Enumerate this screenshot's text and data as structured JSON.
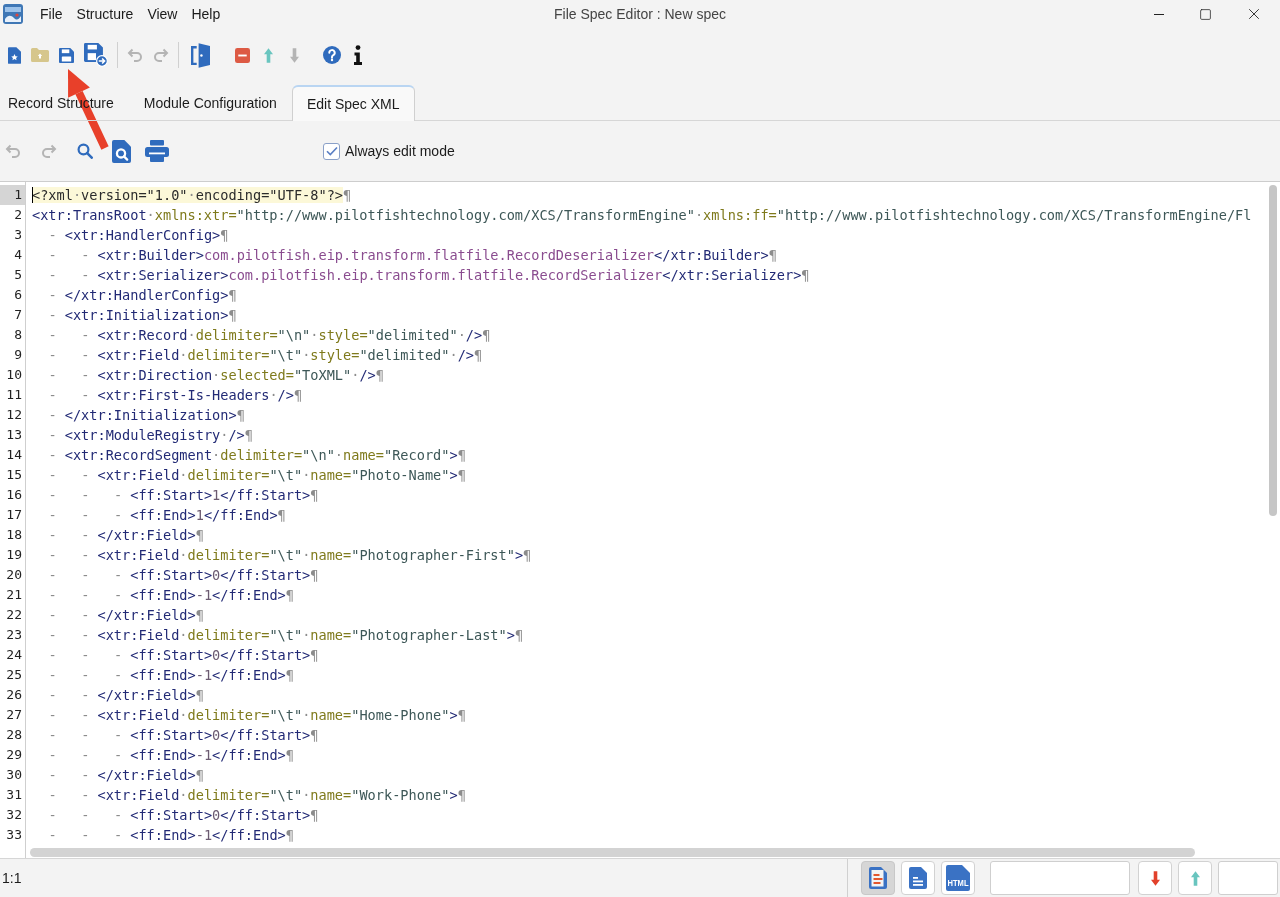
{
  "window": {
    "title": "File Spec Editor : New spec"
  },
  "menu": [
    "File",
    "Structure",
    "View",
    "Help"
  ],
  "toolbar": [
    {
      "kind": "new",
      "disabled": false
    },
    {
      "kind": "open",
      "disabled": false
    },
    {
      "kind": "save",
      "disabled": false
    },
    {
      "kind": "save-as",
      "disabled": false
    },
    {
      "kind": "separator"
    },
    {
      "kind": "undo",
      "disabled": true
    },
    {
      "kind": "redo",
      "disabled": true
    },
    {
      "kind": "separator"
    },
    {
      "kind": "exit",
      "disabled": false
    },
    {
      "kind": "remove",
      "disabled": false
    },
    {
      "kind": "move-up",
      "disabled": false
    },
    {
      "kind": "move-down",
      "disabled": true
    },
    {
      "kind": "help",
      "disabled": false
    },
    {
      "kind": "about",
      "disabled": false
    }
  ],
  "tabs": [
    {
      "label": "Record Structure",
      "selected": false
    },
    {
      "label": "Module Configuration",
      "selected": false
    },
    {
      "label": "Edit Spec XML",
      "selected": true
    }
  ],
  "editor_toolbar": {
    "buttons": [
      {
        "kind": "undo",
        "disabled": true
      },
      {
        "kind": "redo",
        "disabled": true
      },
      {
        "kind": "find",
        "disabled": false
      },
      {
        "kind": "find-in-file",
        "disabled": false
      },
      {
        "kind": "print",
        "disabled": false
      }
    ],
    "always_edit_mode": {
      "label": "Always edit mode",
      "checked": true
    }
  },
  "editor": {
    "lines": [
      {
        "number": "1",
        "current": true,
        "tokens": [
          {
            "kind": "pi",
            "text": "<?xml"
          },
          {
            "kind": "space",
            "text": "·"
          },
          {
            "kind": "pi",
            "text": "version=\"1.0\""
          },
          {
            "kind": "space",
            "text": "·"
          },
          {
            "kind": "pi",
            "text": "encoding=\"UTF-8\"?>"
          },
          {
            "kind": "eol",
            "text": "¶"
          }
        ]
      },
      {
        "number": "2",
        "current": false,
        "tokens": [
          {
            "kind": "tag",
            "text": "<xtr:TransRoot"
          },
          {
            "kind": "space",
            "text": "·"
          },
          {
            "kind": "attr",
            "text": "xmlns:xtr="
          },
          {
            "kind": "value",
            "text": "\"http://www.pilotfishtechnology.com/XCS/TransformEngine\""
          },
          {
            "kind": "space",
            "text": "·"
          },
          {
            "kind": "attr",
            "text": "xmlns:ff="
          },
          {
            "kind": "value",
            "text": "\"http://www.pilotfishtechnology.com/XCS/TransformEngine/Fl"
          }
        ]
      },
      {
        "number": "3",
        "current": false,
        "tokens": [
          {
            "kind": "guide",
            "text": "-"
          },
          {
            "kind": "tag",
            "text": "<xtr:HandlerConfig>"
          },
          {
            "kind": "eol",
            "text": "¶"
          }
        ]
      },
      {
        "number": "4",
        "current": false,
        "tokens": [
          {
            "kind": "guide",
            "text": "-"
          },
          {
            "kind": "guide",
            "text": "-"
          },
          {
            "kind": "tag",
            "text": "<xtr:Builder>"
          },
          {
            "kind": "text",
            "text": "com.pilotfish.eip.transform.flatfile.RecordDeserializer"
          },
          {
            "kind": "tag",
            "text": "</xtr:Builder>"
          },
          {
            "kind": "eol",
            "text": "¶"
          }
        ]
      },
      {
        "number": "5",
        "current": false,
        "tokens": [
          {
            "kind": "guide",
            "text": "-"
          },
          {
            "kind": "guide",
            "text": "-"
          },
          {
            "kind": "tag",
            "text": "<xtr:Serializer>"
          },
          {
            "kind": "text",
            "text": "com.pilotfish.eip.transform.flatfile.RecordSerializer"
          },
          {
            "kind": "tag",
            "text": "</xtr:Serializer>"
          },
          {
            "kind": "eol",
            "text": "¶"
          }
        ]
      },
      {
        "number": "6",
        "current": false,
        "tokens": [
          {
            "kind": "guide",
            "text": "-"
          },
          {
            "kind": "tag",
            "text": "</xtr:HandlerConfig>"
          },
          {
            "kind": "eol",
            "text": "¶"
          }
        ]
      },
      {
        "number": "7",
        "current": false,
        "tokens": [
          {
            "kind": "guide",
            "text": "-"
          },
          {
            "kind": "tag",
            "text": "<xtr:Initialization>"
          },
          {
            "kind": "eol",
            "text": "¶"
          }
        ]
      },
      {
        "number": "8",
        "current": false,
        "tokens": [
          {
            "kind": "guide",
            "text": "-"
          },
          {
            "kind": "guide",
            "text": "-"
          },
          {
            "kind": "tag",
            "text": "<xtr:Record"
          },
          {
            "kind": "space",
            "text": "·"
          },
          {
            "kind": "attr",
            "text": "delimiter="
          },
          {
            "kind": "value",
            "text": "\"\\n\""
          },
          {
            "kind": "space",
            "text": "·"
          },
          {
            "kind": "attr",
            "text": "style="
          },
          {
            "kind": "value",
            "text": "\"delimited\""
          },
          {
            "kind": "space",
            "text": "·"
          },
          {
            "kind": "tag",
            "text": "/>"
          },
          {
            "kind": "eol",
            "text": "¶"
          }
        ]
      },
      {
        "number": "9",
        "current": false,
        "tokens": [
          {
            "kind": "guide",
            "text": "-"
          },
          {
            "kind": "guide",
            "text": "-"
          },
          {
            "kind": "tag",
            "text": "<xtr:Field"
          },
          {
            "kind": "space",
            "text": "·"
          },
          {
            "kind": "attr",
            "text": "delimiter="
          },
          {
            "kind": "value",
            "text": "\"\\t\""
          },
          {
            "kind": "space",
            "text": "·"
          },
          {
            "kind": "attr",
            "text": "style="
          },
          {
            "kind": "value",
            "text": "\"delimited\""
          },
          {
            "kind": "space",
            "text": "·"
          },
          {
            "kind": "tag",
            "text": "/>"
          },
          {
            "kind": "eol",
            "text": "¶"
          }
        ]
      },
      {
        "number": "10",
        "current": false,
        "tokens": [
          {
            "kind": "guide",
            "text": "-"
          },
          {
            "kind": "guide",
            "text": "-"
          },
          {
            "kind": "tag",
            "text": "<xtr:Direction"
          },
          {
            "kind": "space",
            "text": "·"
          },
          {
            "kind": "attr",
            "text": "selected="
          },
          {
            "kind": "value",
            "text": "\"ToXML\""
          },
          {
            "kind": "space",
            "text": "·"
          },
          {
            "kind": "tag",
            "text": "/>"
          },
          {
            "kind": "eol",
            "text": "¶"
          }
        ]
      },
      {
        "number": "11",
        "current": false,
        "tokens": [
          {
            "kind": "guide",
            "text": "-"
          },
          {
            "kind": "guide",
            "text": "-"
          },
          {
            "kind": "tag",
            "text": "<xtr:First-Is-Headers"
          },
          {
            "kind": "space",
            "text": "·"
          },
          {
            "kind": "tag",
            "text": "/>"
          },
          {
            "kind": "eol",
            "text": "¶"
          }
        ]
      },
      {
        "number": "12",
        "current": false,
        "tokens": [
          {
            "kind": "guide",
            "text": "-"
          },
          {
            "kind": "tag",
            "text": "</xtr:Initialization>"
          },
          {
            "kind": "eol",
            "text": "¶"
          }
        ]
      },
      {
        "number": "13",
        "current": false,
        "tokens": [
          {
            "kind": "guide",
            "text": "-"
          },
          {
            "kind": "tag",
            "text": "<xtr:ModuleRegistry"
          },
          {
            "kind": "space",
            "text": "·"
          },
          {
            "kind": "tag",
            "text": "/>"
          },
          {
            "kind": "eol",
            "text": "¶"
          }
        ]
      },
      {
        "number": "14",
        "current": false,
        "tokens": [
          {
            "kind": "guide",
            "text": "-"
          },
          {
            "kind": "tag",
            "text": "<xtr:RecordSegment"
          },
          {
            "kind": "space",
            "text": "·"
          },
          {
            "kind": "attr",
            "text": "delimiter="
          },
          {
            "kind": "value",
            "text": "\"\\n\""
          },
          {
            "kind": "space",
            "text": "·"
          },
          {
            "kind": "attr",
            "text": "name="
          },
          {
            "kind": "value",
            "text": "\"Record\""
          },
          {
            "kind": "tag",
            "text": ">"
          },
          {
            "kind": "eol",
            "text": "¶"
          }
        ]
      },
      {
        "number": "15",
        "current": false,
        "tokens": [
          {
            "kind": "guide",
            "text": "-"
          },
          {
            "kind": "guide",
            "text": "-"
          },
          {
            "kind": "tag",
            "text": "<xtr:Field"
          },
          {
            "kind": "space",
            "text": "·"
          },
          {
            "kind": "attr",
            "text": "delimiter="
          },
          {
            "kind": "value",
            "text": "\"\\t\""
          },
          {
            "kind": "space",
            "text": "·"
          },
          {
            "kind": "attr",
            "text": "name="
          },
          {
            "kind": "value",
            "text": "\"Photo-Name\""
          },
          {
            "kind": "tag",
            "text": ">"
          },
          {
            "kind": "eol",
            "text": "¶"
          }
        ]
      },
      {
        "number": "16",
        "current": false,
        "tokens": [
          {
            "kind": "guide",
            "text": "-"
          },
          {
            "kind": "guide",
            "text": "-"
          },
          {
            "kind": "guide",
            "text": "-"
          },
          {
            "kind": "tag",
            "text": "<ff:Start>"
          },
          {
            "kind": "number",
            "text": "1"
          },
          {
            "kind": "tag",
            "text": "</ff:Start>"
          },
          {
            "kind": "eol",
            "text": "¶"
          }
        ]
      },
      {
        "number": "17",
        "current": false,
        "tokens": [
          {
            "kind": "guide",
            "text": "-"
          },
          {
            "kind": "guide",
            "text": "-"
          },
          {
            "kind": "guide",
            "text": "-"
          },
          {
            "kind": "tag",
            "text": "<ff:End>"
          },
          {
            "kind": "number",
            "text": "1"
          },
          {
            "kind": "tag",
            "text": "</ff:End>"
          },
          {
            "kind": "eol",
            "text": "¶"
          }
        ]
      },
      {
        "number": "18",
        "current": false,
        "tokens": [
          {
            "kind": "guide",
            "text": "-"
          },
          {
            "kind": "guide",
            "text": "-"
          },
          {
            "kind": "tag",
            "text": "</xtr:Field>"
          },
          {
            "kind": "eol",
            "text": "¶"
          }
        ]
      },
      {
        "number": "19",
        "current": false,
        "tokens": [
          {
            "kind": "guide",
            "text": "-"
          },
          {
            "kind": "guide",
            "text": "-"
          },
          {
            "kind": "tag",
            "text": "<xtr:Field"
          },
          {
            "kind": "space",
            "text": "·"
          },
          {
            "kind": "attr",
            "text": "delimiter="
          },
          {
            "kind": "value",
            "text": "\"\\t\""
          },
          {
            "kind": "space",
            "text": "·"
          },
          {
            "kind": "attr",
            "text": "name="
          },
          {
            "kind": "value",
            "text": "\"Photographer-First\""
          },
          {
            "kind": "tag",
            "text": ">"
          },
          {
            "kind": "eol",
            "text": "¶"
          }
        ]
      },
      {
        "number": "20",
        "current": false,
        "tokens": [
          {
            "kind": "guide",
            "text": "-"
          },
          {
            "kind": "guide",
            "text": "-"
          },
          {
            "kind": "guide",
            "text": "-"
          },
          {
            "kind": "tag",
            "text": "<ff:Start>"
          },
          {
            "kind": "number",
            "text": "0"
          },
          {
            "kind": "tag",
            "text": "</ff:Start>"
          },
          {
            "kind": "eol",
            "text": "¶"
          }
        ]
      },
      {
        "number": "21",
        "current": false,
        "tokens": [
          {
            "kind": "guide",
            "text": "-"
          },
          {
            "kind": "guide",
            "text": "-"
          },
          {
            "kind": "guide",
            "text": "-"
          },
          {
            "kind": "tag",
            "text": "<ff:End>"
          },
          {
            "kind": "number",
            "text": "-1"
          },
          {
            "kind": "tag",
            "text": "</ff:End>"
          },
          {
            "kind": "eol",
            "text": "¶"
          }
        ]
      },
      {
        "number": "22",
        "current": false,
        "tokens": [
          {
            "kind": "guide",
            "text": "-"
          },
          {
            "kind": "guide",
            "text": "-"
          },
          {
            "kind": "tag",
            "text": "</xtr:Field>"
          },
          {
            "kind": "eol",
            "text": "¶"
          }
        ]
      },
      {
        "number": "23",
        "current": false,
        "tokens": [
          {
            "kind": "guide",
            "text": "-"
          },
          {
            "kind": "guide",
            "text": "-"
          },
          {
            "kind": "tag",
            "text": "<xtr:Field"
          },
          {
            "kind": "space",
            "text": "·"
          },
          {
            "kind": "attr",
            "text": "delimiter="
          },
          {
            "kind": "value",
            "text": "\"\\t\""
          },
          {
            "kind": "space",
            "text": "·"
          },
          {
            "kind": "attr",
            "text": "name="
          },
          {
            "kind": "value",
            "text": "\"Photographer-Last\""
          },
          {
            "kind": "tag",
            "text": ">"
          },
          {
            "kind": "eol",
            "text": "¶"
          }
        ]
      },
      {
        "number": "24",
        "current": false,
        "tokens": [
          {
            "kind": "guide",
            "text": "-"
          },
          {
            "kind": "guide",
            "text": "-"
          },
          {
            "kind": "guide",
            "text": "-"
          },
          {
            "kind": "tag",
            "text": "<ff:Start>"
          },
          {
            "kind": "number",
            "text": "0"
          },
          {
            "kind": "tag",
            "text": "</ff:Start>"
          },
          {
            "kind": "eol",
            "text": "¶"
          }
        ]
      },
      {
        "number": "25",
        "current": false,
        "tokens": [
          {
            "kind": "guide",
            "text": "-"
          },
          {
            "kind": "guide",
            "text": "-"
          },
          {
            "kind": "guide",
            "text": "-"
          },
          {
            "kind": "tag",
            "text": "<ff:End>"
          },
          {
            "kind": "number",
            "text": "-1"
          },
          {
            "kind": "tag",
            "text": "</ff:End>"
          },
          {
            "kind": "eol",
            "text": "¶"
          }
        ]
      },
      {
        "number": "26",
        "current": false,
        "tokens": [
          {
            "kind": "guide",
            "text": "-"
          },
          {
            "kind": "guide",
            "text": "-"
          },
          {
            "kind": "tag",
            "text": "</xtr:Field>"
          },
          {
            "kind": "eol",
            "text": "¶"
          }
        ]
      },
      {
        "number": "27",
        "current": false,
        "tokens": [
          {
            "kind": "guide",
            "text": "-"
          },
          {
            "kind": "guide",
            "text": "-"
          },
          {
            "kind": "tag",
            "text": "<xtr:Field"
          },
          {
            "kind": "space",
            "text": "·"
          },
          {
            "kind": "attr",
            "text": "delimiter="
          },
          {
            "kind": "value",
            "text": "\"\\t\""
          },
          {
            "kind": "space",
            "text": "·"
          },
          {
            "kind": "attr",
            "text": "name="
          },
          {
            "kind": "value",
            "text": "\"Home-Phone\""
          },
          {
            "kind": "tag",
            "text": ">"
          },
          {
            "kind": "eol",
            "text": "¶"
          }
        ]
      },
      {
        "number": "28",
        "current": false,
        "tokens": [
          {
            "kind": "guide",
            "text": "-"
          },
          {
            "kind": "guide",
            "text": "-"
          },
          {
            "kind": "guide",
            "text": "-"
          },
          {
            "kind": "tag",
            "text": "<ff:Start>"
          },
          {
            "kind": "number",
            "text": "0"
          },
          {
            "kind": "tag",
            "text": "</ff:Start>"
          },
          {
            "kind": "eol",
            "text": "¶"
          }
        ]
      },
      {
        "number": "29",
        "current": false,
        "tokens": [
          {
            "kind": "guide",
            "text": "-"
          },
          {
            "kind": "guide",
            "text": "-"
          },
          {
            "kind": "guide",
            "text": "-"
          },
          {
            "kind": "tag",
            "text": "<ff:End>"
          },
          {
            "kind": "number",
            "text": "-1"
          },
          {
            "kind": "tag",
            "text": "</ff:End>"
          },
          {
            "kind": "eol",
            "text": "¶"
          }
        ]
      },
      {
        "number": "30",
        "current": false,
        "tokens": [
          {
            "kind": "guide",
            "text": "-"
          },
          {
            "kind": "guide",
            "text": "-"
          },
          {
            "kind": "tag",
            "text": "</xtr:Field>"
          },
          {
            "kind": "eol",
            "text": "¶"
          }
        ]
      },
      {
        "number": "31",
        "current": false,
        "tokens": [
          {
            "kind": "guide",
            "text": "-"
          },
          {
            "kind": "guide",
            "text": "-"
          },
          {
            "kind": "tag",
            "text": "<xtr:Field"
          },
          {
            "kind": "space",
            "text": "·"
          },
          {
            "kind": "attr",
            "text": "delimiter="
          },
          {
            "kind": "value",
            "text": "\"\\t\""
          },
          {
            "kind": "space",
            "text": "·"
          },
          {
            "kind": "attr",
            "text": "name="
          },
          {
            "kind": "value",
            "text": "\"Work-Phone\""
          },
          {
            "kind": "tag",
            "text": ">"
          },
          {
            "kind": "eol",
            "text": "¶"
          }
        ]
      },
      {
        "number": "32",
        "current": false,
        "tokens": [
          {
            "kind": "guide",
            "text": "-"
          },
          {
            "kind": "guide",
            "text": "-"
          },
          {
            "kind": "guide",
            "text": "-"
          },
          {
            "kind": "tag",
            "text": "<ff:Start>"
          },
          {
            "kind": "number",
            "text": "0"
          },
          {
            "kind": "tag",
            "text": "</ff:Start>"
          },
          {
            "kind": "eol",
            "text": "¶"
          }
        ]
      },
      {
        "number": "33",
        "current": false,
        "tokens": [
          {
            "kind": "guide",
            "text": "-"
          },
          {
            "kind": "guide",
            "text": "-"
          },
          {
            "kind": "guide",
            "text": "-"
          },
          {
            "kind": "tag",
            "text": "<ff:End>"
          },
          {
            "kind": "number",
            "text": "-1"
          },
          {
            "kind": "tag",
            "text": "</ff:End>"
          },
          {
            "kind": "eol",
            "text": "¶"
          }
        ]
      }
    ]
  },
  "status_bar": {
    "position": "1:1",
    "views": [
      {
        "kind": "text",
        "selected": true
      },
      {
        "kind": "document",
        "selected": false
      },
      {
        "kind": "html",
        "selected": false,
        "icon_text": "HTML"
      }
    ],
    "navigation": [
      {
        "kind": "next",
        "disabled": false
      },
      {
        "kind": "previous",
        "disabled": false
      }
    ]
  }
}
